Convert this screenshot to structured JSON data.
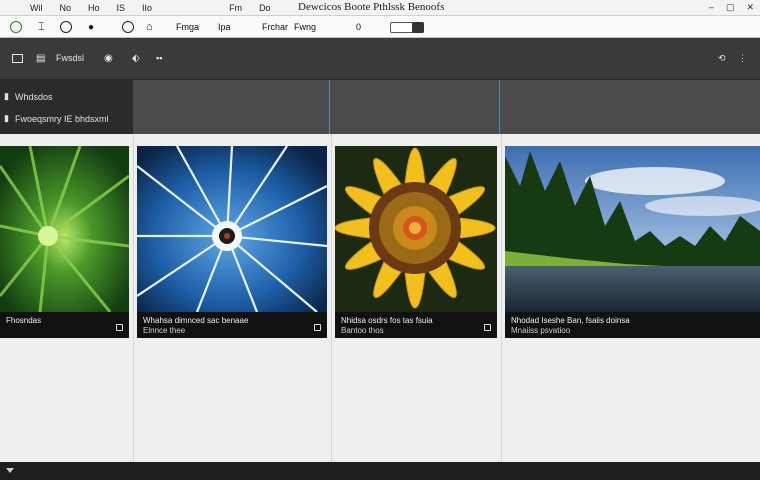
{
  "window": {
    "title": "Dewcicos Boote Pthlssk Benoofs",
    "menus": [
      "Wil",
      "No",
      "Ho",
      "IS",
      "IIo",
      "Fm",
      "Do"
    ],
    "controls": [
      "–",
      "▢",
      "✕"
    ]
  },
  "toolbar": {
    "items": [
      "Fmga",
      "Ipa",
      "Frchar",
      "Fwng"
    ],
    "number": "0"
  },
  "darkbar": {
    "label": "Fwsdsl",
    "right_icons": [
      "⟲",
      "⋮"
    ]
  },
  "left_panel": {
    "rows": [
      {
        "label": "Whdsdos"
      },
      {
        "label": "Fwoeqsmry IE bhdsxml"
      }
    ]
  },
  "cards": [
    {
      "title": "Fhosndas",
      "sub": ""
    },
    {
      "title": "Whahsa dimnced sac benaae",
      "sub": "Elnnce thee"
    },
    {
      "title": "Nhidsa osdrs fos tas fsuia",
      "sub": "Bantoo thos"
    },
    {
      "title": "Nhodad Iseshe Ban, fsaiis doinsa",
      "sub": "Mnaiiss psvatioo"
    }
  ],
  "colors": {
    "accent": "#3d8fd6",
    "dark_bar": "#3a3a3a",
    "panel": "#2b2b2b"
  }
}
